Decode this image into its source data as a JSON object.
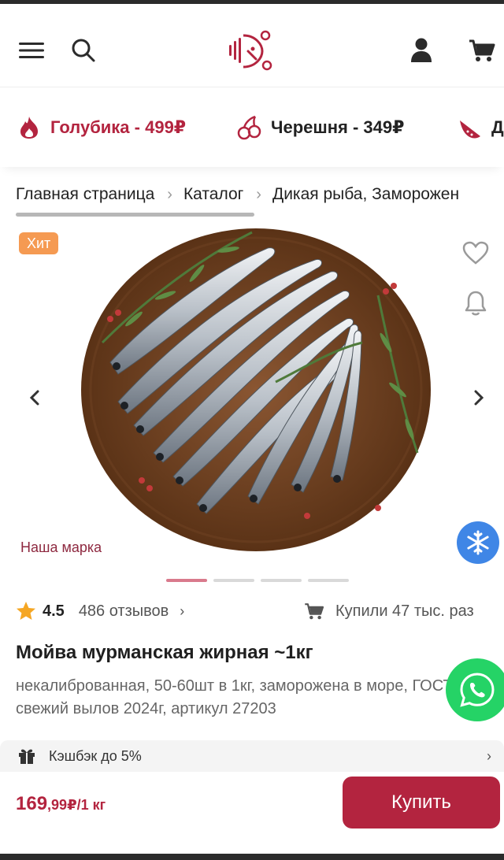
{
  "header": {
    "menu_icon": "hamburger-icon",
    "search_icon": "search-icon",
    "logo_icon": "fish-logo-icon",
    "profile_icon": "user-icon",
    "cart_icon": "cart-icon"
  },
  "promos": [
    {
      "icon": "fire-icon",
      "label": "Голубика - 499₽"
    },
    {
      "icon": "cherry-icon",
      "label": "Черешня - 349₽"
    },
    {
      "icon": "watermelon-icon",
      "label": "Д"
    }
  ],
  "breadcrumbs": [
    "Главная страница",
    "Каталог",
    "Дикая рыба, Заморожен"
  ],
  "gallery": {
    "badge": "Хит",
    "brand_label": "Наша марка",
    "slide_count": 4,
    "active_slide": 1
  },
  "product": {
    "rating": "4.5",
    "reviews": "486 отзывов",
    "bought": "Купили 47 тыс. раз",
    "title": "Мойва мурманская жирная ~1кг",
    "description": "некалиброванная, 50-60шт в 1кг, заморожена в море, ГОСТ, свежий вылов 2024г, артикул 27203"
  },
  "cashback": {
    "label": "Кэшбэк до 5%"
  },
  "buy": {
    "price_main": "169",
    "price_small": ",99₽/1 кг",
    "button_label": "Купить"
  },
  "colors": {
    "accent": "#b3243f",
    "badge": "#f59a52",
    "whatsapp": "#25d366",
    "freeze": "#3f86e6"
  }
}
